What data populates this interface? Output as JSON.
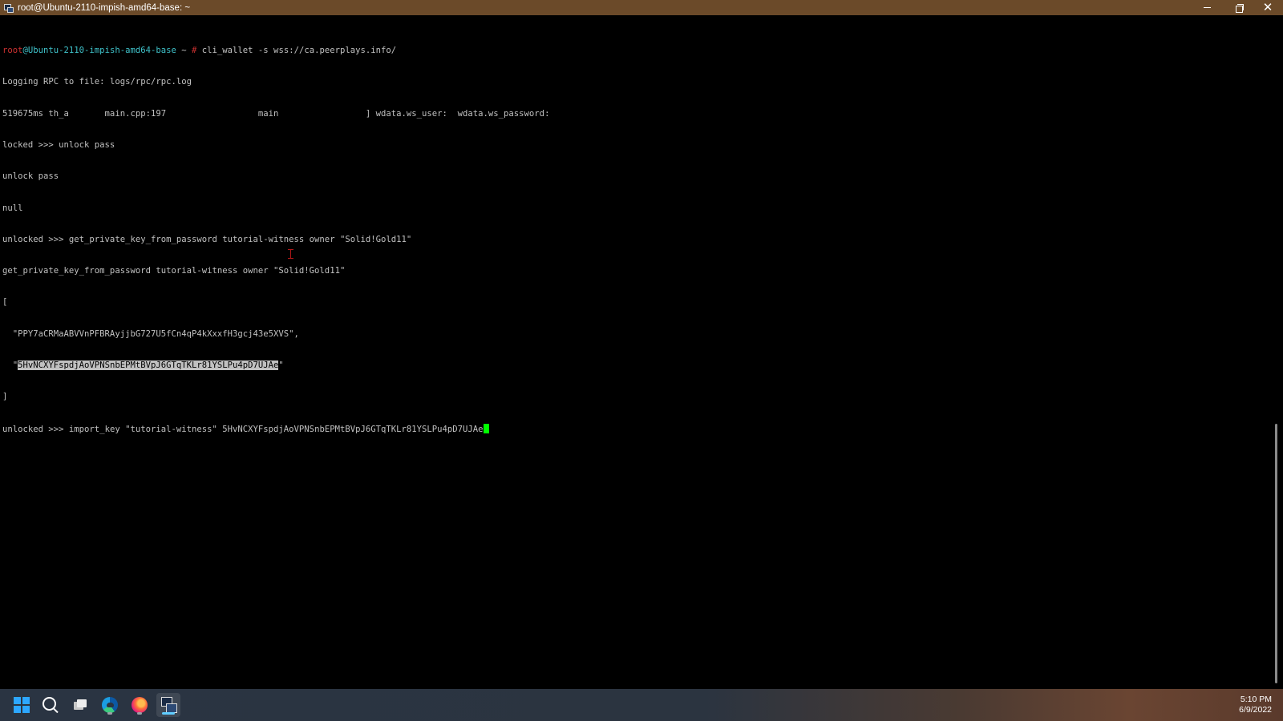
{
  "window": {
    "title": "root@Ubuntu-2110-impish-amd64-base: ~",
    "controls": {
      "minimize": "minimize",
      "maximize": "maximize",
      "close": "✕"
    }
  },
  "terminal": {
    "prompt_user": "root",
    "prompt_host": "@Ubuntu-2110-impish-amd64-base",
    "prompt_path": " ~ ",
    "prompt_symbol": "#",
    "command_1": " cli_wallet -s wss://ca.peerplays.info/",
    "lines": [
      "Logging RPC to file: logs/rpc/rpc.log",
      "519675ms th_a       main.cpp:197                  main                 ] wdata.ws_user:  wdata.ws_password:",
      "locked >>> unlock pass",
      "unlock pass",
      "null",
      "unlocked >>> get_private_key_from_password tutorial-witness owner \"Solid!Gold11\"",
      "get_private_key_from_password tutorial-witness owner \"Solid!Gold11\"",
      "[",
      "  \"PPY7aCRMaABVVnPFBRAyjjbG727U5fCn4qP4kXxxfH3gcj43e5XVS\","
    ],
    "key_line_prefix": "  \"",
    "private_key": "5HvNCXYFspdjAoVPNSnbEPMtBVpJ6GTqTKLr81YSLPu4pD7UJAe",
    "key_line_suffix": "\"",
    "close_bracket": "]",
    "current_prompt": "unlocked >>> ",
    "current_input": "import_key \"tutorial-witness\" 5HvNCXYFspdjAoVPNSnbEPMtBVpJ6GTqTKLr81YSLPu4pD7UJAe"
  },
  "taskbar": {
    "icons": [
      "windows-start-icon",
      "search-icon",
      "task-view-icon",
      "edge-browser-icon",
      "firefox-icon",
      "putty-icon"
    ],
    "clock": {
      "time": "5:10 PM",
      "date": "6/9/2022"
    }
  },
  "colors": {
    "titlebar": "#6b4a29",
    "terminal_bg": "#000000",
    "terminal_fg": "#c0c0c0",
    "prompt_user": "#cd3131",
    "prompt_host": "#3fc1c9",
    "cursor": "#00ff00",
    "selection_bg": "#c0c0c0"
  }
}
